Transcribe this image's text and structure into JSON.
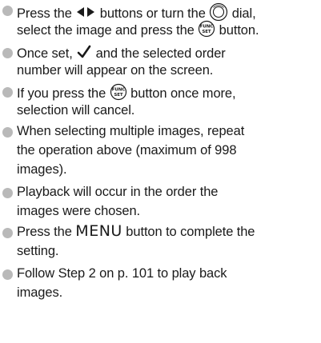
{
  "heading_fragment": "",
  "bullets": [
    {
      "line1_a": "Press the ",
      "line1_b": " buttons or turn the ",
      "line1_c": " dial,",
      "line2_a": "select the image and press the ",
      "line2_b": " button."
    },
    {
      "line1_a": "Once set, ",
      "line1_b": " and the selected order",
      "line2": "number will appear on the screen."
    },
    {
      "line1_a": "If you press the ",
      "line1_b": " button once more,",
      "line2": "selection will cancel."
    },
    {
      "line1": "When selecting multiple images, repeat",
      "line2": "the operation above (maximum of 998",
      "line3": "images)."
    },
    {
      "line1": "Playback will occur in the order the",
      "line2": "images were chosen."
    },
    {
      "line1_a": "Press the ",
      "menu_word": "MENU",
      "line1_b": " button to complete the",
      "line2": "setting."
    },
    {
      "line1": "Follow Step 2 on p. 101 to play back",
      "line2": "images."
    }
  ],
  "icons": {
    "left_right": "left-right-arrow-buttons-icon",
    "dial": "control-dial-icon",
    "func_set": "func-set-button-icon",
    "check": "checkmark-icon"
  },
  "colors": {
    "bullet": "#b9b9b9",
    "text": "#1a1a1a"
  }
}
